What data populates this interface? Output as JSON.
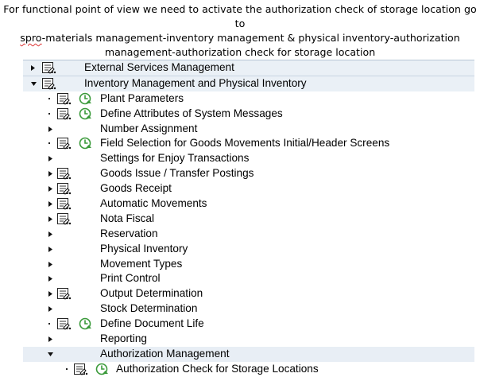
{
  "caption": {
    "line1": "For functional point of view we need to activate the authorization check of storage location go to",
    "line2_spro": "spro",
    "line2_rest": "-materials management-inventory management & physical inventory-authorization",
    "line3": "management-authorization check for storage location"
  },
  "tree": {
    "external_services": "External Services Management",
    "inventory_mgmt": "Inventory Management and Physical Inventory",
    "plant_parameters": "Plant Parameters",
    "define_attributes": "Define Attributes of System Messages",
    "number_assignment": "Number Assignment",
    "field_selection": "Field Selection for Goods Movements Initial/Header Screens",
    "settings_enjoy": "Settings for Enjoy Transactions",
    "goods_issue": "Goods Issue / Transfer Postings",
    "goods_receipt": "Goods Receipt",
    "automatic_movements": "Automatic Movements",
    "nota_fiscal": "Nota Fiscal",
    "reservation": "Reservation",
    "physical_inventory": "Physical Inventory",
    "movement_types": "Movement Types",
    "print_control": "Print Control",
    "output_determination": "Output Determination",
    "stock_determination": "Stock Determination",
    "define_document_life": "Define Document Life",
    "reporting": "Reporting",
    "authorization_management": "Authorization Management",
    "authorization_check": "Authorization Check for Storage Locations"
  },
  "icons": {
    "arrow_collapsed": "triangle-right-icon",
    "arrow_expanded": "triangle-down-icon",
    "document": "img-document-icon",
    "execute": "clock-execute-icon"
  },
  "colors": {
    "highlight_row": "#e8eef5",
    "execute_icon": "#3a9a3a",
    "squiggle": "#dd3333"
  }
}
